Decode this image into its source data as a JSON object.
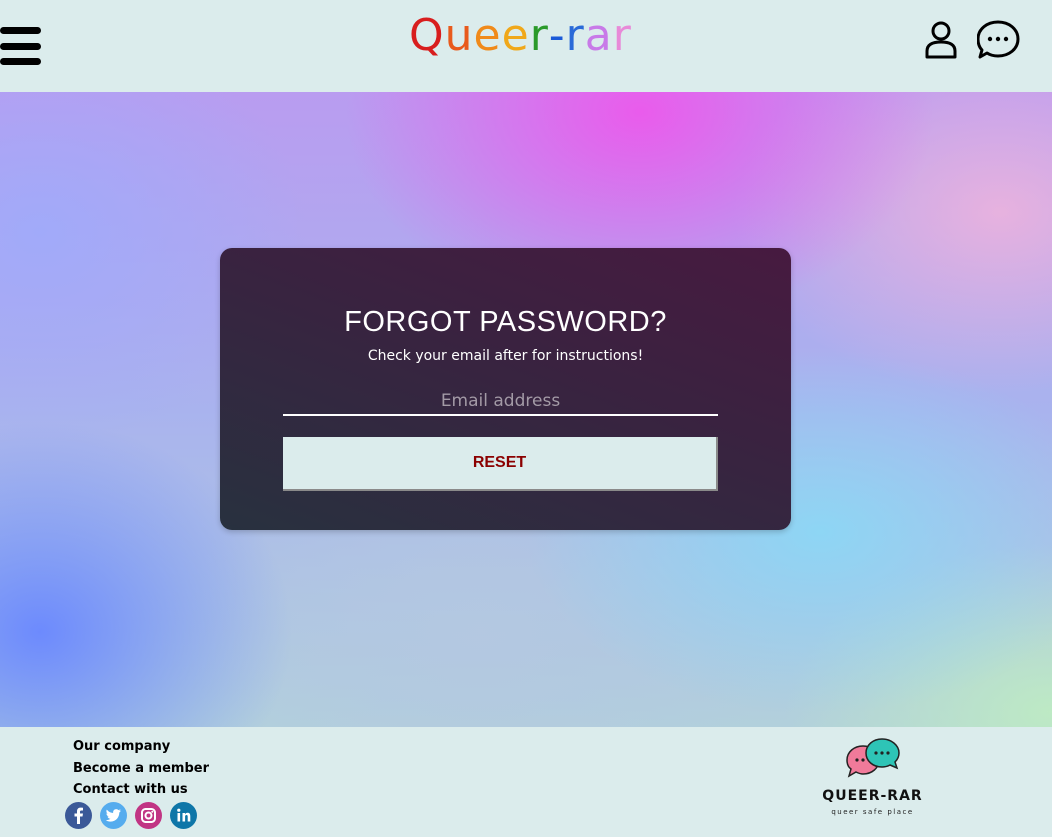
{
  "header": {
    "logo_letters": [
      {
        "char": "Q",
        "color": "#d81e1e"
      },
      {
        "char": "u",
        "color": "#e85a1c"
      },
      {
        "char": "e",
        "color": "#f08a1a"
      },
      {
        "char": "e",
        "color": "#f0a81a"
      },
      {
        "char": "r",
        "color": "#2a9a2a"
      },
      {
        "char": "-",
        "color": "#1a5ad8"
      },
      {
        "char": "r",
        "color": "#2a6ad8"
      },
      {
        "char": "a",
        "color": "#c87ae8"
      },
      {
        "char": "r",
        "color": "#e88ad8"
      }
    ],
    "icons": {
      "menu": "hamburger-menu-icon",
      "profile": "user-icon",
      "chat": "chat-bubble-icon"
    }
  },
  "form": {
    "title": "FORGOT PASSWORD?",
    "subtitle": "Check your email after for instructions!",
    "email_placeholder": "Email address",
    "email_value": "",
    "reset_label": "RESET"
  },
  "footer": {
    "links": [
      "Our company",
      "Become a member",
      "Contact with us"
    ],
    "social": [
      {
        "name": "facebook",
        "color": "#3b5998",
        "glyph": "f"
      },
      {
        "name": "twitter",
        "color": "#55acee",
        "glyph": "t"
      },
      {
        "name": "instagram",
        "color": "#c13584",
        "glyph": "◎"
      },
      {
        "name": "linkedin",
        "color": "#0e76a8",
        "glyph": "in"
      }
    ],
    "brand_name": "QUEER-RAR",
    "brand_tagline": "queer safe place"
  },
  "colors": {
    "background": "#dbecec",
    "accent": "#8b0000",
    "card": "#3a2240"
  }
}
